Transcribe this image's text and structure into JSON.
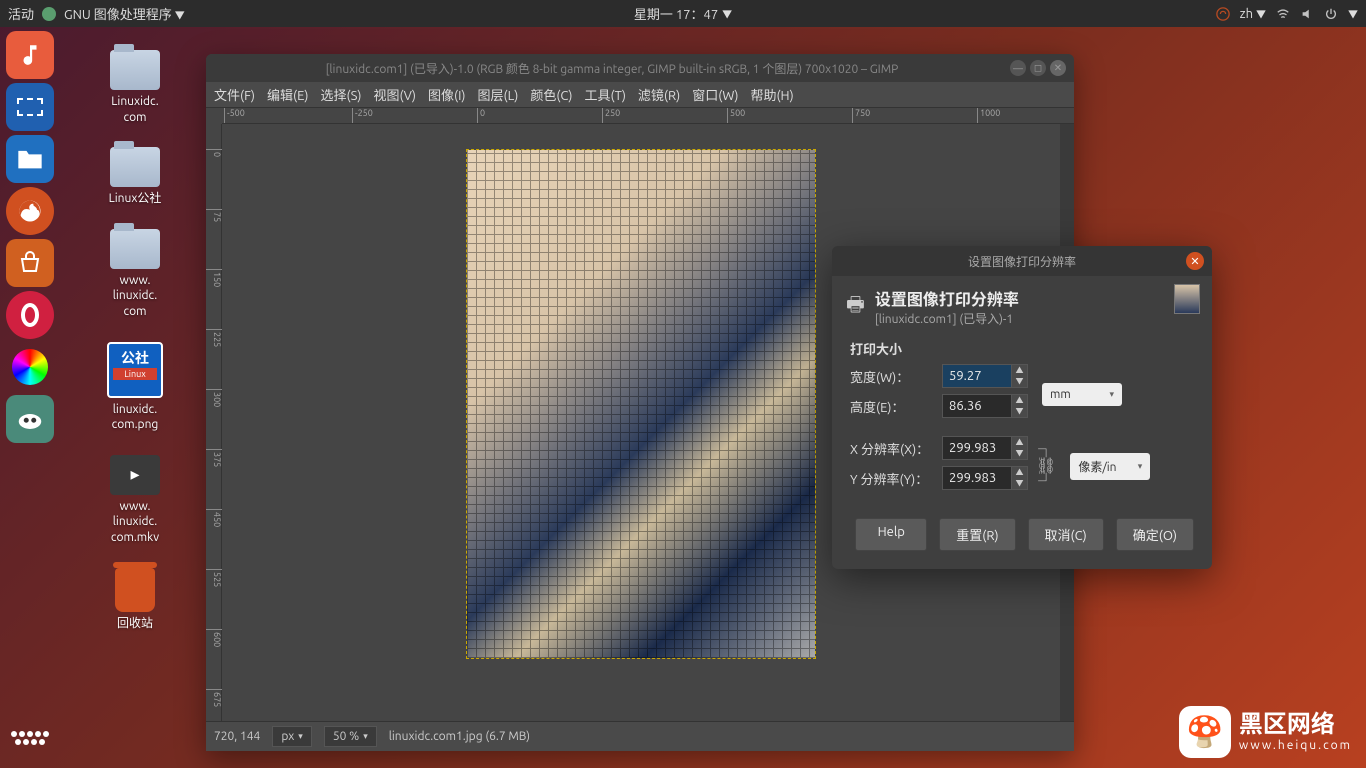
{
  "topbar": {
    "activities": "活动",
    "app": "GNU 图像处理程序",
    "datetime": "星期一 17：47",
    "ime": "zh"
  },
  "desktop": {
    "icons": [
      {
        "label": "Linuxidc.\ncom",
        "type": "folder"
      },
      {
        "label": "Linux公社",
        "type": "folder"
      },
      {
        "label": "www.\nlinuxidc.\ncom",
        "type": "folder"
      },
      {
        "label": "linuxidc.\ncom.png",
        "type": "img"
      },
      {
        "label": "www.\nlinuxidc.\ncom.mkv",
        "type": "vid"
      },
      {
        "label": "回收站",
        "type": "trash"
      }
    ]
  },
  "gimp": {
    "title": "[linuxidc.com1] (已导入)-1.0 (RGB 颜色 8-bit gamma integer, GIMP built-in sRGB, 1 个图层) 700x1020 – GIMP",
    "menus": [
      "文件(F)",
      "编辑(E)",
      "选择(S)",
      "视图(V)",
      "图像(I)",
      "图层(L)",
      "颜色(C)",
      "工具(T)",
      "滤镜(R)",
      "窗口(W)",
      "帮助(H)"
    ],
    "ruler_h": [
      "-500",
      "-250",
      "0",
      "250",
      "500",
      "750",
      "1000"
    ],
    "ruler_v": [
      "0",
      "75",
      "150",
      "225",
      "300",
      "375",
      "450",
      "525",
      "600",
      "675"
    ],
    "status": {
      "coords": "720, 144",
      "unit": "px",
      "zoom": "50 %",
      "file": "linuxidc.com1.jpg (6.7 MB)"
    }
  },
  "dialog": {
    "window_title": "设置图像打印分辨率",
    "header_title": "设置图像打印分辨率",
    "header_sub": "[linuxidc.com1] (已导入)-1",
    "print_size_label": "打印大小",
    "width_label": "宽度(W)：",
    "width_value": "59.27",
    "height_label": "高度(E)：",
    "height_value": "86.36",
    "size_unit": "mm",
    "xres_label": "X 分辨率(X)：",
    "xres_value": "299.983",
    "yres_label": "Y 分辨率(Y)：",
    "yres_value": "299.983",
    "res_unit": "像素/in",
    "buttons": {
      "help": "Help",
      "reset": "重置(R)",
      "cancel": "取消(C)",
      "ok": "确定(O)"
    }
  },
  "watermark": {
    "line1": "黑区网络",
    "line2": "www.heiqu.com"
  }
}
